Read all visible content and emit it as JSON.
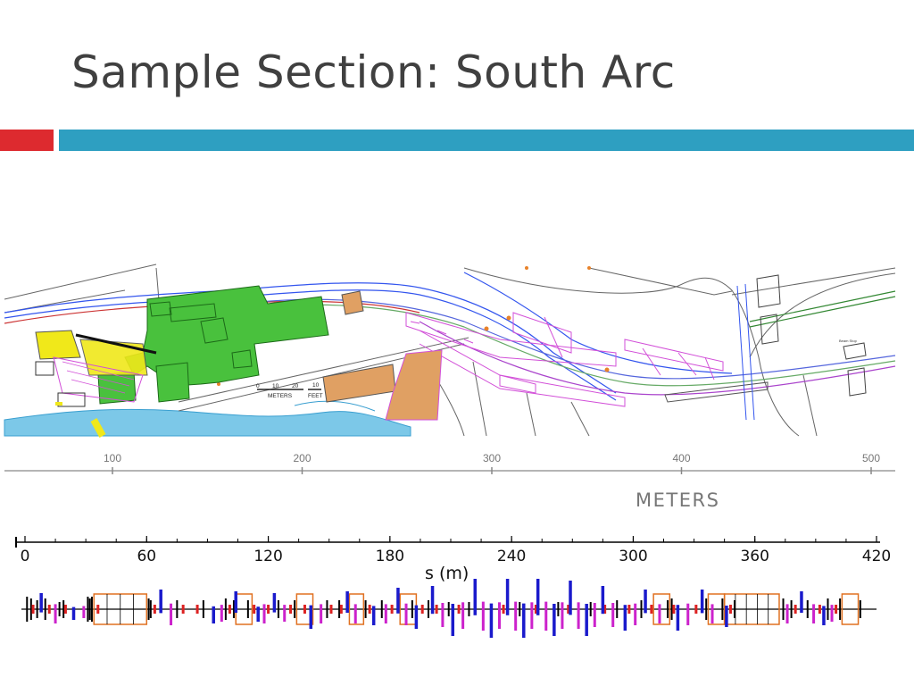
{
  "slide": {
    "title": "Sample Section: South Arc"
  },
  "site_map": {
    "scale_bar_top_labels": [
      "0",
      "10",
      "20"
    ],
    "scale_bar_top_unit": "METERS",
    "scale_bar_bottom_labels": [
      "10"
    ],
    "scale_bar_bottom_unit": "FEET",
    "annotation": "Beam Stop",
    "colors": {
      "building": "#49c13d",
      "annex": "#e0a063",
      "water": "#7cc8e8",
      "magenta": "#d24fd8",
      "yellow": "#f0e81a"
    }
  },
  "meters_axis": {
    "ticks": [
      {
        "value": 100,
        "label": "100"
      },
      {
        "value": 200,
        "label": "200"
      },
      {
        "value": 300,
        "label": "300"
      },
      {
        "value": 400,
        "label": "400"
      },
      {
        "value": 500,
        "label": "500"
      }
    ],
    "range": [
      50,
      500
    ],
    "unit_label": "METERS"
  },
  "lattice_axis": {
    "ticks": [
      {
        "value": 0,
        "label": "0"
      },
      {
        "value": 60,
        "label": "60"
      },
      {
        "value": 120,
        "label": "120"
      },
      {
        "value": 180,
        "label": "180"
      },
      {
        "value": 240,
        "label": "240"
      },
      {
        "value": 300,
        "label": "300"
      },
      {
        "value": 360,
        "label": "360"
      },
      {
        "value": 420,
        "label": "420"
      }
    ],
    "range": [
      0,
      420
    ],
    "minor_step": 15,
    "label": "s (m)"
  },
  "lattice": {
    "colors": {
      "dipole": "#e07020",
      "quad_focus": "#1a1acc",
      "quad_defocus": "#cc22cc",
      "corrector": "#dd2222",
      "element": "#000000"
    },
    "dipoles": [
      {
        "s_start": 34,
        "s_end": 60
      },
      {
        "s_start": 104,
        "s_end": 112
      },
      {
        "s_start": 134,
        "s_end": 142
      },
      {
        "s_start": 160,
        "s_end": 167
      },
      {
        "s_start": 185,
        "s_end": 193
      },
      {
        "s_start": 310,
        "s_end": 318
      },
      {
        "s_start": 337,
        "s_end": 345
      },
      {
        "s_start": 345,
        "s_end": 372
      },
      {
        "s_start": 403,
        "s_end": 411
      }
    ],
    "quads_blue": [
      {
        "s": 8,
        "h": 18
      },
      {
        "s": 24,
        "h": 12
      },
      {
        "s": 67,
        "h": 22
      },
      {
        "s": 93,
        "h": 16
      },
      {
        "s": 104,
        "h": 20
      },
      {
        "s": 115,
        "h": 14
      },
      {
        "s": 123,
        "h": 18
      },
      {
        "s": 141,
        "h": 22
      },
      {
        "s": 159,
        "h": 20
      },
      {
        "s": 172,
        "h": 18
      },
      {
        "s": 184,
        "h": 24
      },
      {
        "s": 193,
        "h": 22
      },
      {
        "s": 201,
        "h": 26
      },
      {
        "s": 211,
        "h": 30
      },
      {
        "s": 222,
        "h": 34
      },
      {
        "s": 230,
        "h": 32
      },
      {
        "s": 238,
        "h": 34
      },
      {
        "s": 246,
        "h": 32
      },
      {
        "s": 253,
        "h": 34
      },
      {
        "s": 261,
        "h": 30
      },
      {
        "s": 269,
        "h": 32
      },
      {
        "s": 277,
        "h": 30
      },
      {
        "s": 285,
        "h": 26
      },
      {
        "s": 296,
        "h": 24
      },
      {
        "s": 306,
        "h": 22
      },
      {
        "s": 322,
        "h": 24
      },
      {
        "s": 334,
        "h": 22
      },
      {
        "s": 346,
        "h": 20
      },
      {
        "s": 383,
        "h": 20
      },
      {
        "s": 394,
        "h": 18
      }
    ],
    "quads_magenta": [
      {
        "s": 15,
        "h": 16
      },
      {
        "s": 29,
        "h": 10
      },
      {
        "s": 72,
        "h": 18
      },
      {
        "s": 97,
        "h": 14
      },
      {
        "s": 118,
        "h": 16
      },
      {
        "s": 128,
        "h": 14
      },
      {
        "s": 146,
        "h": 16
      },
      {
        "s": 163,
        "h": 16
      },
      {
        "s": 178,
        "h": 16
      },
      {
        "s": 188,
        "h": 18
      },
      {
        "s": 206,
        "h": 20
      },
      {
        "s": 216,
        "h": 22
      },
      {
        "s": 226,
        "h": 24
      },
      {
        "s": 234,
        "h": 22
      },
      {
        "s": 242,
        "h": 24
      },
      {
        "s": 250,
        "h": 22
      },
      {
        "s": 257,
        "h": 24
      },
      {
        "s": 265,
        "h": 22
      },
      {
        "s": 273,
        "h": 22
      },
      {
        "s": 281,
        "h": 20
      },
      {
        "s": 290,
        "h": 20
      },
      {
        "s": 301,
        "h": 18
      },
      {
        "s": 313,
        "h": 16
      },
      {
        "s": 327,
        "h": 18
      },
      {
        "s": 339,
        "h": 16
      },
      {
        "s": 376,
        "h": 16
      },
      {
        "s": 389,
        "h": 16
      },
      {
        "s": 398,
        "h": 14
      }
    ],
    "correctors": [
      4,
      12,
      20,
      36,
      64,
      78,
      85,
      101,
      113,
      120,
      131,
      138,
      151,
      156,
      170,
      181,
      196,
      203,
      214,
      236,
      252,
      268,
      286,
      298,
      309,
      320,
      331,
      348,
      380,
      392,
      400
    ],
    "black_elements": [
      {
        "s": 1,
        "h": 14
      },
      {
        "s": 3,
        "h": 12
      },
      {
        "s": 6,
        "h": 10
      },
      {
        "s": 10,
        "h": 12
      },
      {
        "s": 17,
        "h": 8
      },
      {
        "s": 19,
        "h": 10
      },
      {
        "s": 31,
        "h": 14
      },
      {
        "s": 32,
        "h": 12
      },
      {
        "s": 33,
        "h": 14
      },
      {
        "s": 61,
        "h": 12
      },
      {
        "s": 62,
        "h": 10
      },
      {
        "s": 75,
        "h": 10
      },
      {
        "s": 88,
        "h": 10
      },
      {
        "s": 99,
        "h": 12
      },
      {
        "s": 103,
        "h": 10
      },
      {
        "s": 110,
        "h": 10
      },
      {
        "s": 125,
        "h": 10
      },
      {
        "s": 133,
        "h": 10
      },
      {
        "s": 149,
        "h": 10
      },
      {
        "s": 155,
        "h": 10
      },
      {
        "s": 168,
        "h": 10
      },
      {
        "s": 176,
        "h": 10
      },
      {
        "s": 191,
        "h": 10
      },
      {
        "s": 199,
        "h": 10
      },
      {
        "s": 209,
        "h": 8
      },
      {
        "s": 219,
        "h": 8
      },
      {
        "s": 244,
        "h": 8
      },
      {
        "s": 263,
        "h": 8
      },
      {
        "s": 279,
        "h": 8
      },
      {
        "s": 292,
        "h": 10
      },
      {
        "s": 304,
        "h": 10
      },
      {
        "s": 317,
        "h": 10
      },
      {
        "s": 319,
        "h": 12
      },
      {
        "s": 336,
        "h": 12
      },
      {
        "s": 344,
        "h": 12
      },
      {
        "s": 350,
        "h": 10
      },
      {
        "s": 374,
        "h": 12
      },
      {
        "s": 378,
        "h": 10
      },
      {
        "s": 386,
        "h": 10
      },
      {
        "s": 396,
        "h": 12
      },
      {
        "s": 402,
        "h": 12
      },
      {
        "s": 412,
        "h": 10
      }
    ]
  }
}
